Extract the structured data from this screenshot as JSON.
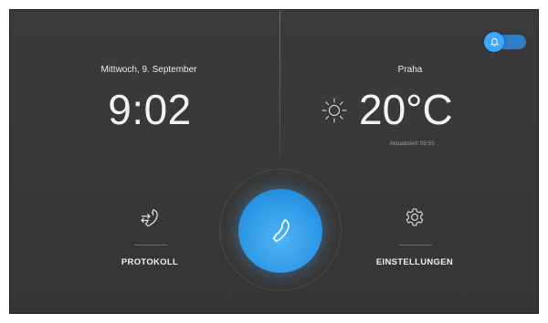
{
  "left_panel": {
    "date": "Mittwoch, 9. September",
    "time": "9:02",
    "button_label": "PROTOKOLL"
  },
  "right_panel": {
    "city": "Praha",
    "temperature": "20°C",
    "updated": "Aktualisiert 08:55",
    "button_label": "EINSTELLUNGEN"
  },
  "toggle": {
    "state": "on",
    "icon": "bell-icon"
  },
  "call_button": {
    "icon": "phone-icon"
  },
  "colors": {
    "background": "#3a3a3a",
    "accent": "#3ba7ff",
    "text": "#f3f3f3",
    "muted": "#9a9a9a"
  }
}
